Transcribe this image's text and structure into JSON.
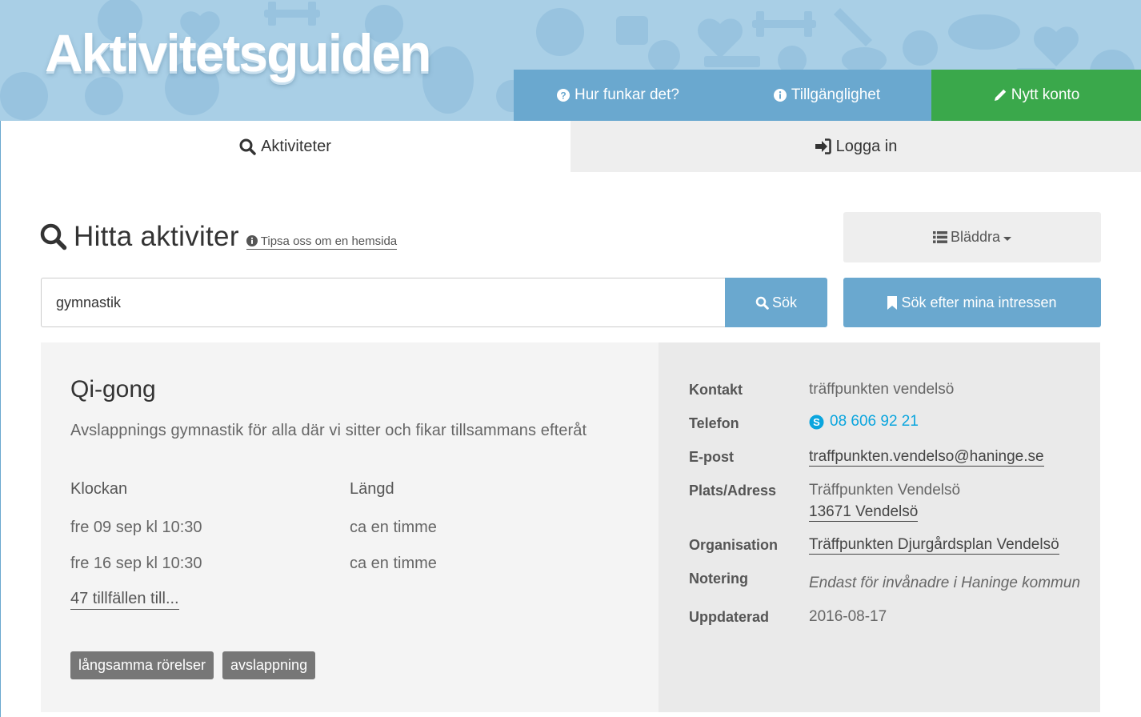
{
  "header": {
    "logo": "Aktivitetsguiden",
    "nav": {
      "how_label": "Hur funkar det?",
      "accessibility_label": "Tillgänglighet",
      "new_account_label": "Nytt konto"
    }
  },
  "tabs": {
    "activities_label": "Aktiviteter",
    "login_label": "Logga in"
  },
  "search": {
    "title": "Hitta aktiviter",
    "tip_label": "Tipsa oss om en hemsida",
    "browse_label": "Bläddra",
    "query_value": "gymnastik",
    "search_label": "Sök",
    "interests_label": "Sök efter mina intressen"
  },
  "result": {
    "title": "Qi-gong",
    "description": "Avslappnings gymnastik för alla där vi sitter och fikar tillsammans efteråt",
    "schedule": {
      "time_header": "Klockan",
      "length_header": "Längd",
      "rows": [
        {
          "time": "fre 09 sep kl 10:30",
          "length": "ca en timme"
        },
        {
          "time": "fre 16 sep kl 10:30",
          "length": "ca en timme"
        }
      ],
      "more_label": "47 tillfällen till..."
    },
    "tags": [
      "långsamma rörelser",
      "avslappning"
    ],
    "info": {
      "contact_label": "Kontakt",
      "contact_value": "träffpunkten vendelsö",
      "phone_label": "Telefon",
      "phone_value": "08 606 92 21",
      "email_label": "E-post",
      "email_value": "traffpunkten.vendelso@haninge.se",
      "address_label": "Plats/Adress",
      "address_line1": "Träffpunkten Vendelsö",
      "address_line2": "13671 Vendelsö",
      "org_label": "Organisation",
      "org_value": "Träffpunkten Djurgårdsplan Vendelsö",
      "note_label": "Notering",
      "note_value": "Endast för invånadre i Haninge kommun",
      "updated_label": "Uppdaterad",
      "updated_value": "2016-08-17"
    }
  },
  "colors": {
    "header_bg": "#a9cfe6",
    "nav_blue": "#6aa8cf",
    "nav_green": "#3aa84b",
    "phone_link": "#0aa5de",
    "tag_bg": "#777777"
  }
}
